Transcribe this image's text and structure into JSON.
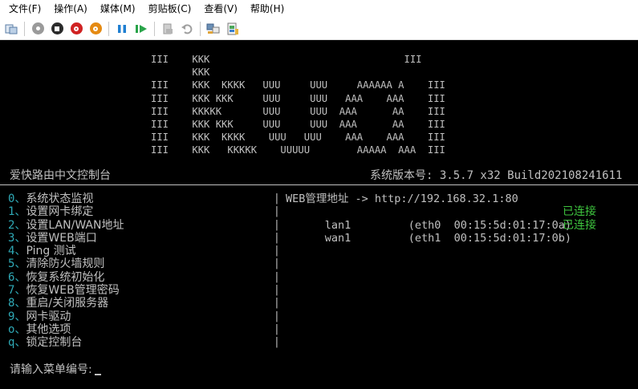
{
  "menubar": {
    "items": [
      "文件(F)",
      "操作(A)",
      "媒体(M)",
      "剪贴板(C)",
      "查看(V)",
      "帮助(H)"
    ]
  },
  "toolbar": {
    "icons": [
      "settings-icon",
      "ctrl-alt-del-icon",
      "stop-icon",
      "shutdown-icon",
      "power-icon",
      "pause-icon",
      "start-icon",
      "checkpoint-icon",
      "revert-icon",
      "share-icon",
      "enhanced-session-icon"
    ]
  },
  "console": {
    "ascii_art": [
      "III    KKK                                 III",
      "       KKK",
      "III    KKK  KKKK   UUU     UUU     AAAAAA A    III",
      "III    KKK KKK     UUU     UUU   AAA    AAA    III",
      "III    KKKKK       UUU     UUU  AAA      AA    III",
      "III    KKK KKK     UUU     UUU  AAA      AA    III",
      "III    KKK  KKKK    UUU   UUU    AAA    AAA    III",
      "III    KKK   KKKKK    UUUUU        AAAAA  AAA  III"
    ],
    "title_left": "爱快路由中文控制台",
    "title_right": "系统版本号: 3.5.7 x32 Build202108241611",
    "menu_options": [
      {
        "key": "0、",
        "label": "系统状态监视"
      },
      {
        "key": "1、",
        "label": "设置网卡绑定"
      },
      {
        "key": "2、",
        "label": "设置LAN/WAN地址"
      },
      {
        "key": "3、",
        "label": "设置WEB端口"
      },
      {
        "key": "4、",
        "label": "Ping 测试"
      },
      {
        "key": "5、",
        "label": "清除防火墙规则"
      },
      {
        "key": "6、",
        "label": "恢复系统初始化"
      },
      {
        "key": "7、",
        "label": "恢复WEB管理密码"
      },
      {
        "key": "8、",
        "label": "重启/关闭服务器"
      },
      {
        "key": "9、",
        "label": "网卡驱动"
      },
      {
        "key": "o、",
        "label": "其他选项"
      },
      {
        "key": "q、",
        "label": "锁定控制台"
      }
    ],
    "web_address": "WEB管理地址 -> http://192.168.32.1:80",
    "interfaces": [
      {
        "name": "lan1",
        "detail": "(eth0  00:15:5d:01:17:0a)",
        "status": "已连接"
      },
      {
        "name": "wan1",
        "detail": "(eth1  00:15:5d:01:17:0b)",
        "status": "已连接"
      }
    ],
    "prompt": "请输入菜单编号:",
    "colors": {
      "background": "#000000",
      "text": "#c0c0c0",
      "key": "#2fa9b6",
      "connected": "#3ec43e"
    }
  }
}
